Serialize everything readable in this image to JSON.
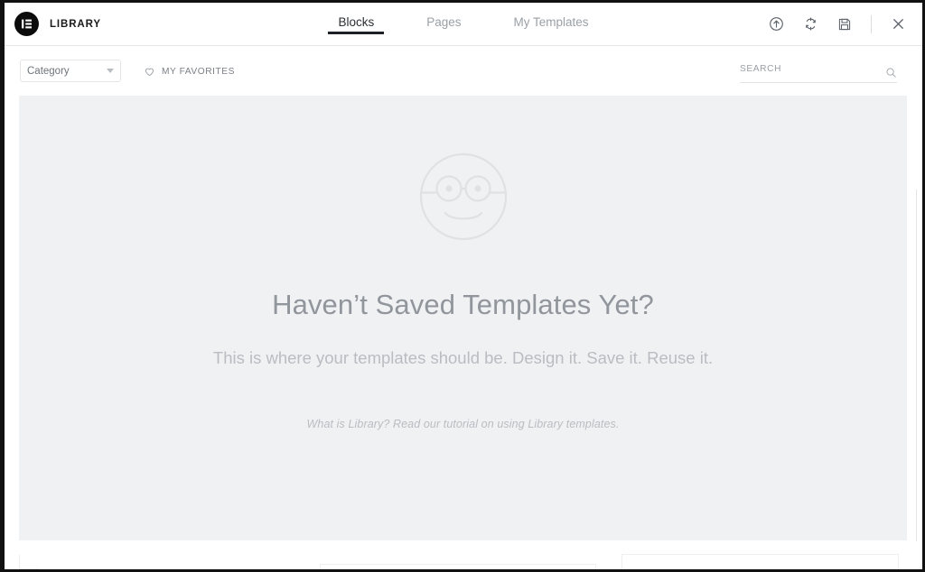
{
  "header": {
    "brand_title": "LIBRARY",
    "logo_icon": "elementor-logo-icon",
    "tabs": [
      {
        "label": "Blocks",
        "active": true
      },
      {
        "label": "Pages",
        "active": false
      },
      {
        "label": "My Templates",
        "active": false
      }
    ],
    "actions": [
      {
        "name": "upload-icon",
        "title": "Import Template"
      },
      {
        "name": "sync-icon",
        "title": "Sync Library"
      },
      {
        "name": "save-icon",
        "title": "Save"
      },
      {
        "name": "close-icon",
        "title": "Close"
      }
    ]
  },
  "toolbar": {
    "category_label": "Category",
    "category_caret": "chevron-down-icon",
    "favorites_label": "MY FAVORITES",
    "favorites_icon": "heart-icon",
    "search_value": "",
    "search_placeholder": "SEARCH",
    "search_icon": "search-icon"
  },
  "empty_state": {
    "icon": "smiley-glasses-icon",
    "title": "Haven’t Saved Templates Yet?",
    "subtitle": "This is where your templates should be. Design it. Save it. Reuse it.",
    "tutorial_text": "What is Library? Read our tutorial on using Library templates."
  },
  "colors": {
    "panel_background": "#f0f1f3",
    "modal_background": "#ffffff",
    "frame": "#111111",
    "active_tab": "#2c2f33",
    "inactive_tab": "#9aa0a6",
    "title_text": "#91969c",
    "muted_text": "#b9bdc2"
  }
}
